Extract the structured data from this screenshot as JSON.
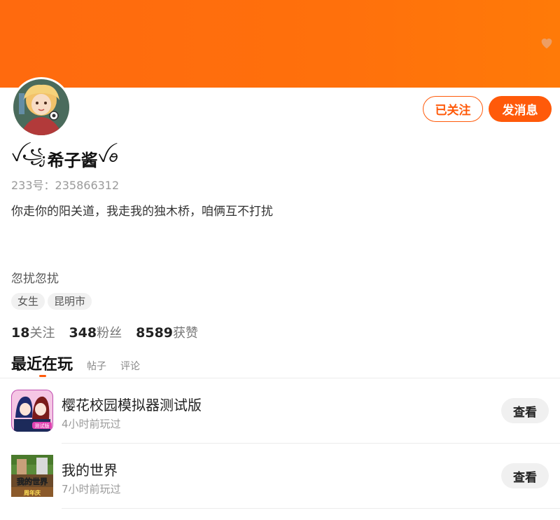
{
  "profile": {
    "follow_button": "已关注",
    "message_button": "发消息",
    "nickname_prefix": "ꪜ꧁",
    "nickname": "希子酱",
    "nickname_suffix": "ꪜꪮ",
    "account_id": "233号：235866312",
    "bio_line1": "你走你的阳关道，我走我的独木桥，咱俩互不打扰",
    "bio_line2": "忽扰忽扰",
    "tags": [
      "女生",
      "昆明市"
    ]
  },
  "stats": [
    {
      "value": "18",
      "label": "关注"
    },
    {
      "value": "348",
      "label": "粉丝"
    },
    {
      "value": "8589",
      "label": "获赞"
    }
  ],
  "tabs": {
    "active": "最近在玩",
    "posts": "帖子",
    "comments": "评论"
  },
  "games": [
    {
      "name": "樱花校园模拟器测试版",
      "time": "4小时前玩过",
      "action": "查看",
      "icon": "sakura-school-icon",
      "badge": "测试版"
    },
    {
      "name": "我的世界",
      "time": "7小时前玩过",
      "action": "查看",
      "icon": "minecraft-icon",
      "badge": "周年庆",
      "icon_title": "我的世界"
    }
  ],
  "colors": {
    "accent": "#ff5a0a",
    "banner": "#ff6a0e"
  }
}
